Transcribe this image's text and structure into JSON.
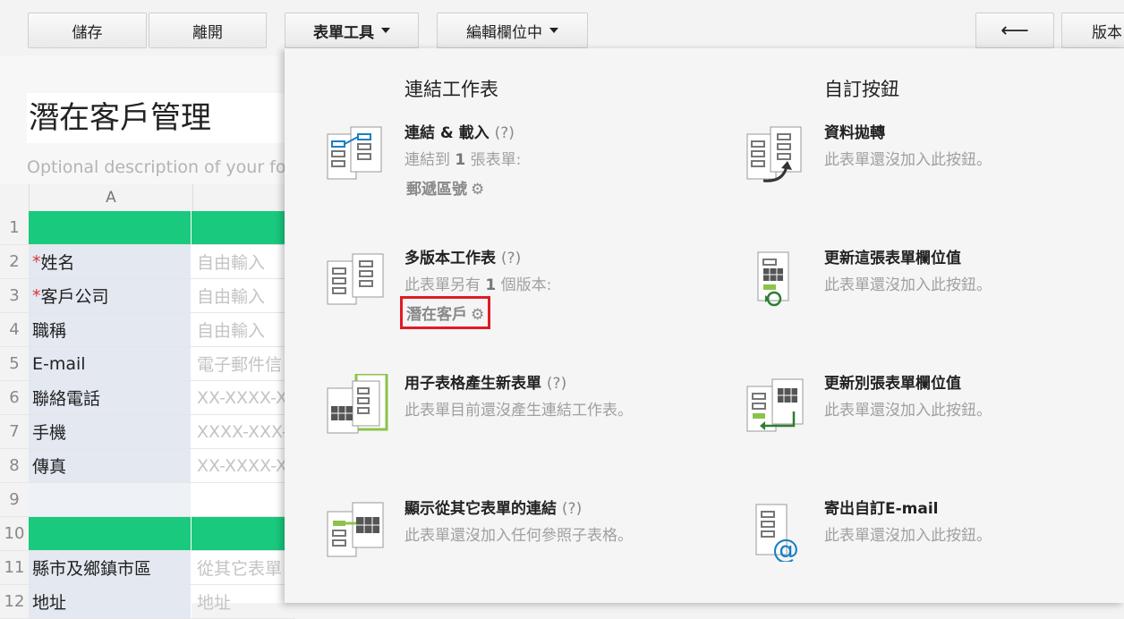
{
  "toolbar": {
    "save": "儲存",
    "leave": "離開",
    "form_tools": "表單工具",
    "editing": "編輯欄位中",
    "back_arrow": "⟵",
    "version": "版本"
  },
  "form": {
    "title": "潛在客戶管理",
    "description": "Optional description of your fo",
    "column_a": "A"
  },
  "rows": [
    {
      "num": "1",
      "label": "",
      "value": "",
      "type": "green"
    },
    {
      "num": "2",
      "label": "姓名",
      "required": "*",
      "value": "自由輸入"
    },
    {
      "num": "3",
      "label": "客戶公司",
      "required": "*",
      "value": "自由輸入"
    },
    {
      "num": "4",
      "label": "職稱",
      "value": "自由輸入"
    },
    {
      "num": "5",
      "label": "E-mail",
      "value": "電子郵件信"
    },
    {
      "num": "6",
      "label": "聯絡電話",
      "value": "XX-XXXX-XX"
    },
    {
      "num": "7",
      "label": "手機",
      "value": "XXXX-XXX-X"
    },
    {
      "num": "8",
      "label": "傳真",
      "value": "XX-XXXX-XX"
    },
    {
      "num": "9",
      "label": "",
      "value": ""
    },
    {
      "num": "10",
      "label": "",
      "value": "",
      "type": "green"
    },
    {
      "num": "11",
      "label": "縣市及鄉鎮市區",
      "value": "從其它表單"
    },
    {
      "num": "12",
      "label": "地址",
      "value": "地址"
    }
  ],
  "menu": {
    "left_heading": "連結工作表",
    "right_heading": "自訂按鈕",
    "help": "(?)",
    "link_load": {
      "title": "連結 & 載入",
      "desc_pre": "連結到",
      "desc_num": "1",
      "desc_post": "張表單:",
      "link": "郵遞區號"
    },
    "multi_version": {
      "title": "多版本工作表",
      "desc_pre": "此表單另有",
      "desc_num": "1",
      "desc_post": "個版本:",
      "link": "潛在客戶"
    },
    "subtable_new": {
      "title": "用子表格產生新表單",
      "desc": "此表單目前還沒產生連結工作表。"
    },
    "show_links": {
      "title": "顯示從其它表單的連結",
      "desc": "此表單還沒加入任何參照子表格。"
    },
    "data_transfer": {
      "title": "資料拋轉",
      "desc": "此表單還沒加入此按鈕。"
    },
    "update_this": {
      "title": "更新這張表單欄位值",
      "desc": "此表單還沒加入此按鈕。"
    },
    "update_other": {
      "title": "更新別張表單欄位值",
      "desc": "此表單還沒加入此按鈕。"
    },
    "send_email": {
      "title": "寄出自訂E-mail",
      "desc": "此表單還沒加入此按鈕。"
    }
  },
  "colors": {
    "green": "#19c97e",
    "highlight": "#e01b24",
    "label_bg": "#e3e8f1"
  }
}
